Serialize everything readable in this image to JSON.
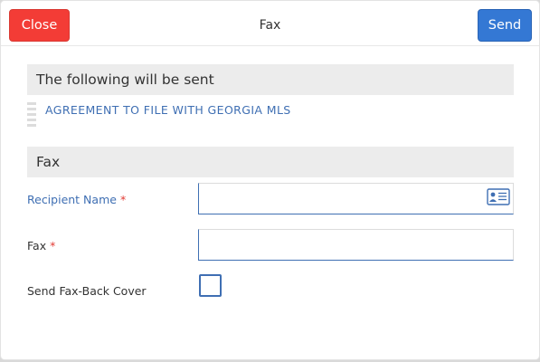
{
  "header": {
    "close_label": "Close",
    "title": "Fax",
    "send_label": "Send"
  },
  "documents_section": {
    "heading": "The following will be sent",
    "items": [
      {
        "label": "AGREEMENT TO FILE WITH GEORGIA MLS"
      }
    ]
  },
  "fax_section": {
    "heading": "Fax",
    "recipient": {
      "label": "Recipient Name",
      "required_mark": "*",
      "value": "",
      "icon": "contact-card-icon"
    },
    "fax_number": {
      "label": "Fax",
      "required_mark": "*",
      "value": ""
    },
    "fax_back_cover": {
      "label": "Send Fax-Back Cover",
      "checked": false
    }
  },
  "colors": {
    "close": "#f33c36",
    "send": "#3478d4",
    "link": "#3f6fb3",
    "required": "#e23b34",
    "section_bg": "#ececec"
  }
}
